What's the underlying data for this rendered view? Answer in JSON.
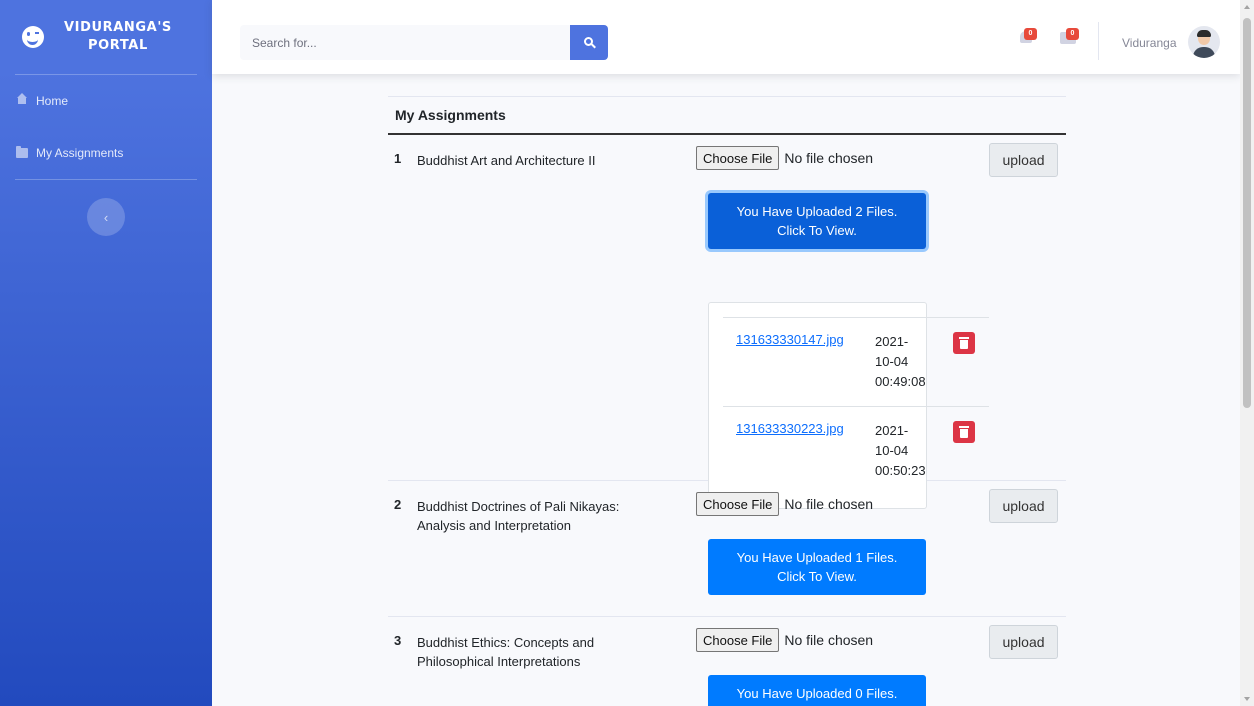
{
  "brand": {
    "line1": "VIDURANGA'S",
    "line2": "PORTAL"
  },
  "sidebar": {
    "items": [
      {
        "label": "Home",
        "icon": "home-icon"
      },
      {
        "label": "My Assignments",
        "icon": "folder-icon"
      }
    ],
    "toggle_glyph": "‹"
  },
  "topbar": {
    "search_placeholder": "Search for...",
    "alerts_count": "0",
    "messages_count": "0",
    "username": "Viduranga"
  },
  "table": {
    "header": "My Assignments",
    "choose_file_label": "Choose File",
    "no_file_text": "No file chosen",
    "upload_label": "upload",
    "rows": [
      {
        "number": "1",
        "name": "Buddhist Art and Architecture II",
        "view_line1": "You Have Uploaded 2 Files.",
        "view_line2": "Click To View.",
        "files": [
          {
            "name": "131633330147.jpg",
            "date1": "2021-",
            "date2": "10-04",
            "time": "00:49:08"
          },
          {
            "name": "131633330223.jpg",
            "date1": "2021-",
            "date2": "10-04",
            "time": "00:50:23"
          }
        ]
      },
      {
        "number": "2",
        "name": "Buddhist Doctrines of Pali Nikayas: Analysis and Interpretation",
        "view_line1": "You Have Uploaded 1 Files.",
        "view_line2": "Click To View."
      },
      {
        "number": "3",
        "name": "Buddhist Ethics: Concepts and Philosophical Interpretations",
        "view_line1": "You Have Uploaded 0 Files."
      }
    ]
  },
  "colors": {
    "primary": "#4e73df",
    "button_blue": "#007bff",
    "danger": "#dc3545",
    "badge": "#e74a3b"
  }
}
